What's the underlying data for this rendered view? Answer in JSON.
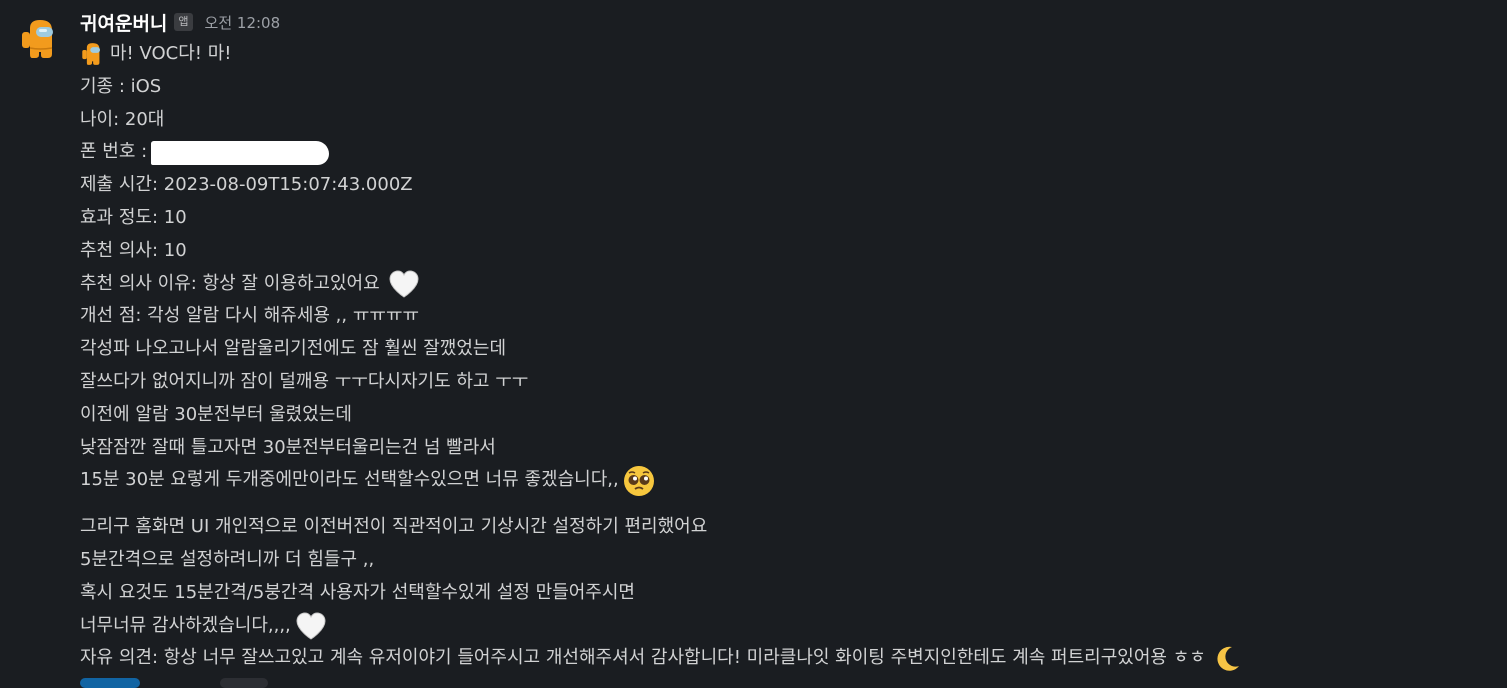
{
  "message": {
    "sender": "귀여운버니",
    "badge": "앱",
    "time": "오전 12:08",
    "title": "마! VOC다! 마!",
    "fields": {
      "device": "기종 : iOS",
      "age": "나이: 20대",
      "phone_label": "폰 번호 :",
      "submitted": "제출 시간: 2023-08-09T15:07:43.000Z",
      "effect": "효과 정도: 10",
      "recommend": "추천 의사: 10",
      "recommend_reason": "추천 의사 이유: 항상 잘 이용하고있어요",
      "improve": "개선 점: 각성 알람 다시 해쥬세용 ,, ㅠㅠㅠㅠ"
    },
    "lines_a": [
      "각성파 나오고나서 알람울리기전에도 잠 훨씬 잘깼었는데",
      "잘쓰다가 없어지니까 잠이 덜깨용 ㅜㅜ다시자기도 하고 ㅜㅜ",
      "이전에 알람 30분전부터 울렸었는데",
      "낮잠잠깐 잘때 틀고자면 30분전부터울리는건 넘 빨라서",
      "15분 30분 요렇게 두개중에만이라도 선택할수있으면 너뮤 좋겠습니다,,"
    ],
    "lines_b": [
      "그리구 홈화면 UI 개인적으로 이전버전이 직관적이고 기상시간 설정하기 편리했어요",
      "5분간격으로 설정하려니까 더 힘들구 ,,",
      "혹시 요것도 15분간격/5붕간격 사용자가 선택할수있게 설정 만들어주시면",
      "너무너뮤 감사하겠습니다,,,,"
    ],
    "free_opinion": "자유 의견: 항상 너무 잘쓰고있고 계속 유저이야기 들어주시고 개선해주셔서 감사합니다! 미라클나잇 화이팅 주변지인한테도 계속 퍼트리구있어용 ㅎㅎ"
  },
  "icons": [
    "crewmate-avatar-icon",
    "crewmate-emoji-icon",
    "white-heart-icon",
    "pleading-face-icon",
    "crescent-moon-icon"
  ],
  "colors": {
    "background": "#1a1d21",
    "text": "#d1d2d3",
    "avatar": "#f29b1d",
    "visor": "#9ecbe0"
  }
}
